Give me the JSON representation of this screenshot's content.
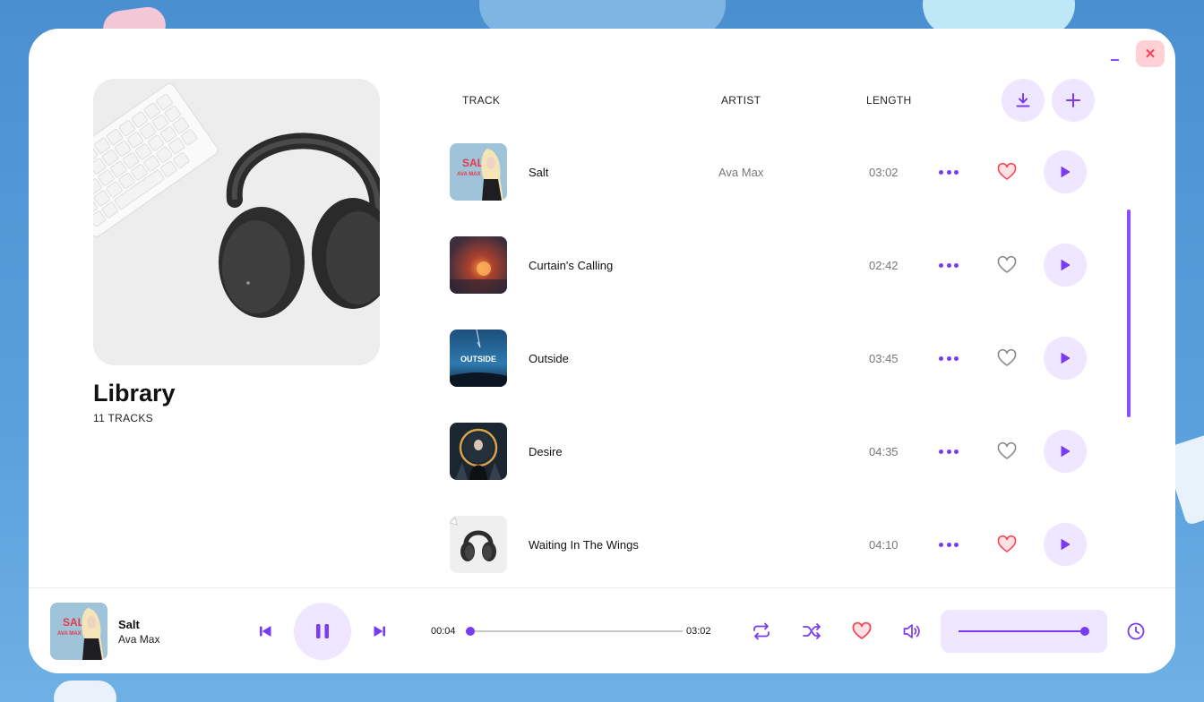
{
  "window": {
    "minimize_label": "–",
    "close_label": "✕"
  },
  "library": {
    "title": "Library",
    "count": "11 TRACKS"
  },
  "columns": {
    "track": "TRACK",
    "artist": "ARTIST",
    "length": "LENGTH"
  },
  "header_actions": [
    "download-icon",
    "plus-icon"
  ],
  "tracks": [
    {
      "title": "Salt",
      "artist": "Ava Max",
      "length": "03:02",
      "liked": true,
      "art": "salt"
    },
    {
      "title": "Curtain's Calling",
      "artist": "",
      "length": "02:42",
      "liked": false,
      "art": "curtain"
    },
    {
      "title": "Outside",
      "artist": "",
      "length": "03:45",
      "liked": false,
      "art": "outside"
    },
    {
      "title": "Desire",
      "artist": "",
      "length": "04:35",
      "liked": false,
      "art": "desire"
    },
    {
      "title": "Waiting In The Wings",
      "artist": "",
      "length": "04:10",
      "liked": true,
      "art": "headphones"
    }
  ],
  "now_playing": {
    "title": "Salt",
    "artist": "Ava Max",
    "current_time": "00:04",
    "total_time": "03:02",
    "progress": 0.022,
    "liked": true,
    "volume": 1.0
  },
  "colors": {
    "accent": "#7a3cf0",
    "accent_light": "#efe6ff",
    "heart_liked": "#f0475a",
    "heart_empty": "#8a8a8a"
  }
}
